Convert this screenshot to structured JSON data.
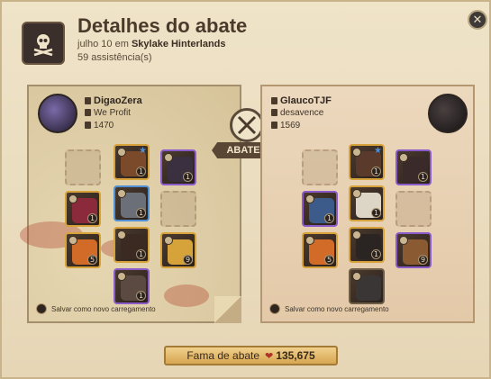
{
  "header": {
    "title": "Detalhes do abate",
    "date": "julho 10",
    "location_prefix": "em",
    "location": "Skylake Hinterlands",
    "assists": "59 assistência(s)"
  },
  "killer": {
    "name": "DigaoZera",
    "guild": "We Profit",
    "ip": "1470",
    "save_label": "Salvar como novo carregamento"
  },
  "victim": {
    "name": "GlaucoTJF",
    "guild": "desavence",
    "ip": "1569",
    "save_label": "Salvar como novo carregamento"
  },
  "center": {
    "killed_label": "ABATEU"
  },
  "fame": {
    "label": "Fama de abate",
    "value": "135,675"
  },
  "colors": {
    "gold_border": "#d7a23a",
    "purple_border": "#8a5bc9",
    "blue_border": "#4f8fd6"
  }
}
